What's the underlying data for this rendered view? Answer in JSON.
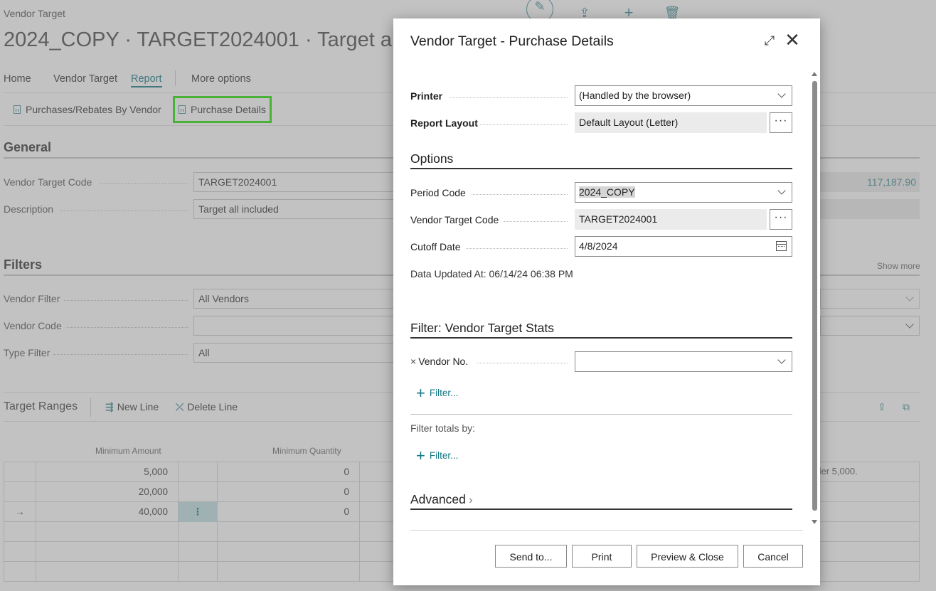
{
  "page": {
    "breadcrumb": "Vendor Target",
    "title": "2024_COPY · TARGET2024001 · Target all inc",
    "nav": [
      "Home",
      "Vendor Target",
      "Report",
      "More options"
    ],
    "actions": [
      "Purchases/Rebates By Vendor",
      "Purchase Details"
    ],
    "general": {
      "title": "General",
      "vendor_target_code_label": "Vendor Target Code",
      "vendor_target_code": "TARGET2024001",
      "description_label": "Description",
      "description": "Target all included",
      "right_value": "117,187.90"
    },
    "filters": {
      "title": "Filters",
      "show_more": "Show more",
      "vendor_filter_label": "Vendor Filter",
      "vendor_filter": "All Vendors",
      "vendor_code_label": "Vendor Code",
      "vendor_code": "",
      "type_filter_label": "Type Filter",
      "type_filter": "All"
    },
    "target_ranges": {
      "title": "Target Ranges",
      "new_line": "New Line",
      "delete_line": "Delete Line",
      "columns": [
        "Minimum Amount",
        "Minimum Quantity"
      ],
      "rows": [
        {
          "marker": "",
          "min_amount": "5,000",
          "min_qty": "0"
        },
        {
          "marker": "",
          "min_amount": "20,000",
          "min_qty": "0"
        },
        {
          "marker": "→",
          "min_amount": "40,000",
          "min_qty": "0"
        }
      ],
      "row_menu": "⋮",
      "right_note": "nder 5,000."
    }
  },
  "dialog": {
    "title": "Vendor Target - Purchase Details",
    "printer_label": "Printer",
    "printer_value": "(Handled by the browser)",
    "report_layout_label": "Report Layout",
    "report_layout_value": "Default Layout (Letter)",
    "ellipsis": "···",
    "options_title": "Options",
    "period_code_label": "Period Code",
    "period_code_value": "2024_COPY",
    "vendor_target_code_label": "Vendor Target Code",
    "vendor_target_code_value": "TARGET2024001",
    "cutoff_date_label": "Cutoff Date",
    "cutoff_date_value": "4/8/2024",
    "data_updated": "Data Updated At: 06/14/24 06:38 PM",
    "filter_section_title": "Filter: Vendor Target Stats",
    "vendor_no_label": "Vendor No.",
    "vendor_no_value": "",
    "add_filter_label": "Filter...",
    "filter_totals_label": "Filter totals by:",
    "advanced_label": "Advanced",
    "buttons": {
      "send_to": "Send to...",
      "print": "Print",
      "preview_close": "Preview & Close",
      "cancel": "Cancel"
    }
  },
  "colors": {
    "accent": "#157784",
    "highlight_box": "#22e000",
    "overlay": "#787878"
  }
}
